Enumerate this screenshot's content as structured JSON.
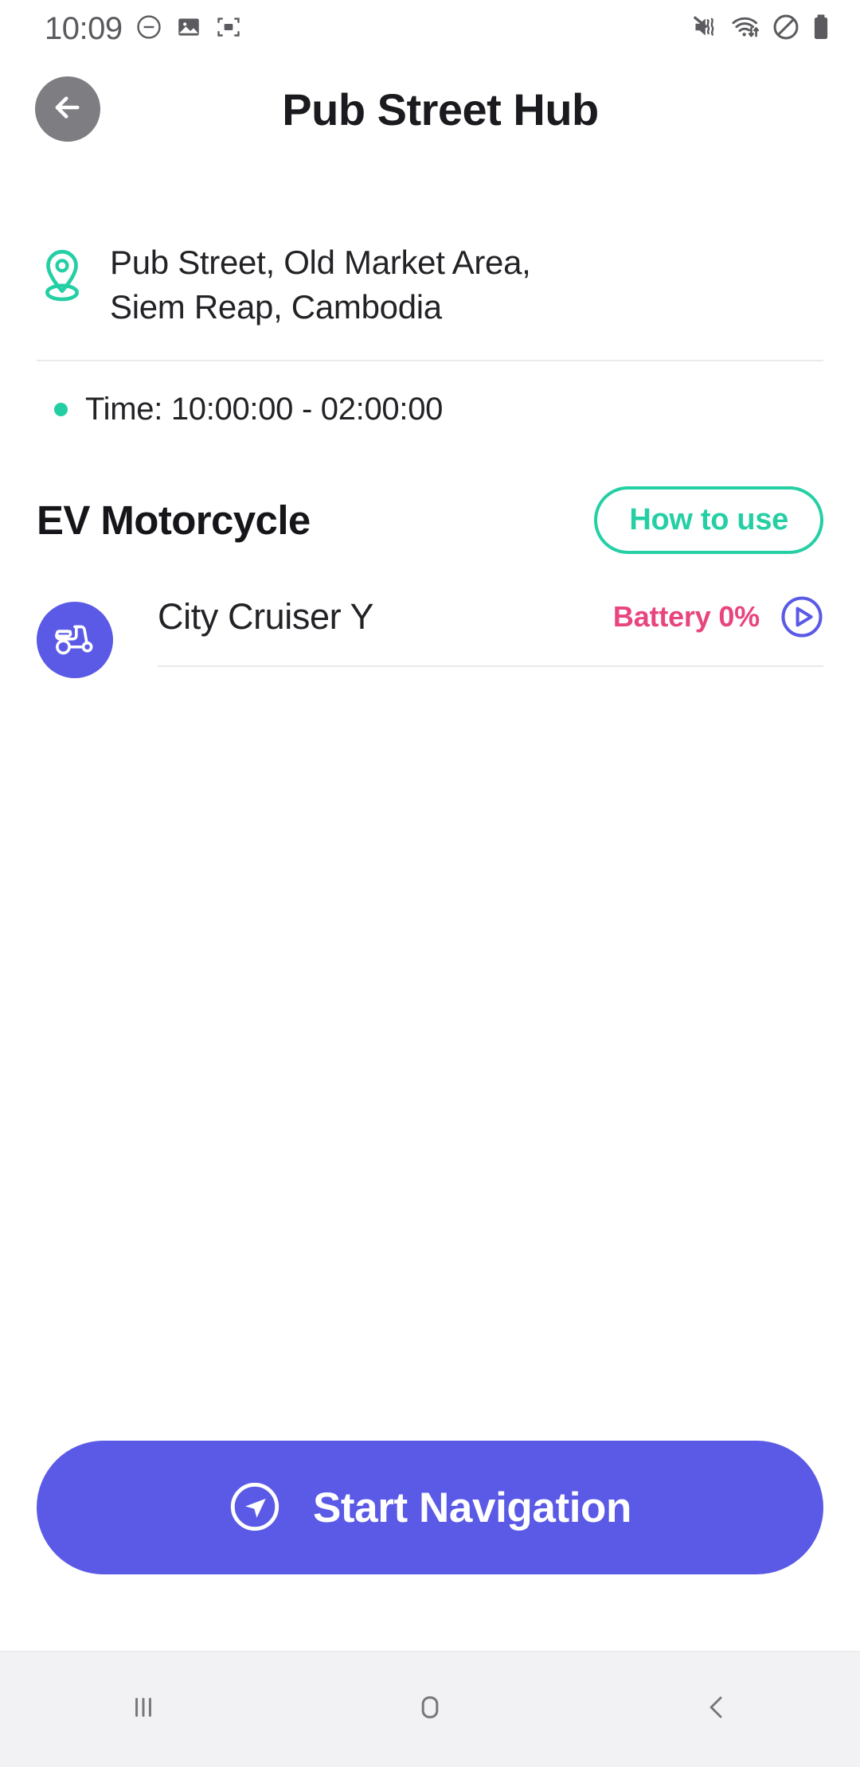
{
  "status_bar": {
    "clock": "10:09",
    "left_icons": [
      "minus-circle-icon",
      "image-icon",
      "screenshot-crop-icon"
    ],
    "right_icons": [
      "mute-vibrate-icon",
      "wifi-transfer-icon",
      "do-not-disturb-icon",
      "battery-icon"
    ]
  },
  "header": {
    "back_icon": "arrow-left-icon",
    "title": "Pub Street Hub"
  },
  "location": {
    "pin_icon": "map-pin-icon",
    "address": "Pub Street, Old Market Area, Siem Reap, Cambodia",
    "time_label": "Time: 10:00:00 - 02:00:00"
  },
  "vehicle_section": {
    "title": "EV Motorcycle",
    "how_to_use_label": "How to use",
    "items": [
      {
        "icon": "scooter-icon",
        "name": "City Cruiser Y",
        "battery": "Battery 0%",
        "action_icon": "play-circle-icon"
      }
    ]
  },
  "cta": {
    "icon": "navigation-arrow-icon",
    "label": "Start Navigation"
  },
  "navbar": {
    "recents_label": "recents-icon",
    "home_label": "home-icon",
    "back_label": "back-icon"
  },
  "colors": {
    "teal": "#25cfa4",
    "indigo": "#5a5ae6",
    "pink": "#e8457f",
    "text": "#232327",
    "divider": "#e9e9ee",
    "navbar_bg": "#f2f2f4"
  }
}
